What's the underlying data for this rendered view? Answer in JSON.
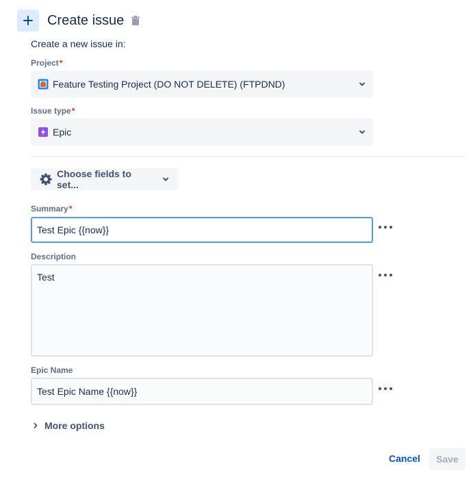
{
  "header": {
    "title": "Create issue",
    "add_icon": "plus-icon",
    "delete_icon": "trash-icon"
  },
  "intro": "Create a new issue in:",
  "project": {
    "label": "Project",
    "required_mark": "*",
    "value": "Feature Testing Project (DO NOT DELETE) (FTPDND)",
    "icon": "project-avatar-icon"
  },
  "issue_type": {
    "label": "Issue type",
    "required_mark": "*",
    "value": "Epic",
    "icon": "epic-lightning-icon",
    "icon_color": "#904ee2"
  },
  "choose_fields": {
    "label": "Choose fields to set...",
    "icon": "gear-icon"
  },
  "summary": {
    "label": "Summary",
    "required_mark": "*",
    "value": "Test Epic {{now}}"
  },
  "description": {
    "label": "Description",
    "value": "Test"
  },
  "epic_name": {
    "label": "Epic Name",
    "value": "Test Epic Name {{now}}"
  },
  "more_options": "More options",
  "footer": {
    "cancel": "Cancel",
    "save": "Save"
  },
  "colors": {
    "accent": "#0052cc",
    "focus": "#4c9aff",
    "required": "#de350b"
  }
}
